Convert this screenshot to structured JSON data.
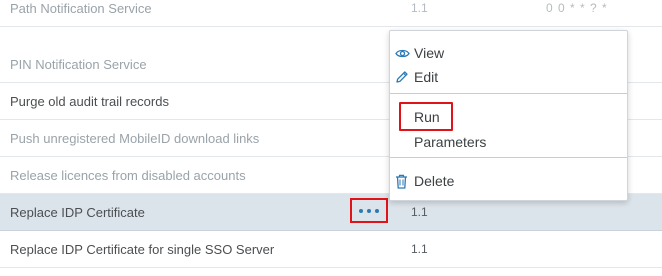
{
  "table": {
    "rows": [
      {
        "name": "Path Notification Service",
        "version": "1.1",
        "schedule": "0 0 * * ? *"
      },
      {
        "name": "PIN Notification Service",
        "version": "",
        "schedule": ""
      },
      {
        "name": "Purge old audit trail records",
        "version": "",
        "schedule": ""
      },
      {
        "name": "Push unregistered MobileID download links",
        "version": "",
        "schedule": ""
      },
      {
        "name": "Release licences from disabled accounts",
        "version": "",
        "schedule": ""
      },
      {
        "name": "Replace IDP Certificate",
        "version": "1.1",
        "schedule": ""
      },
      {
        "name": "Replace IDP Certificate for single SSO Server",
        "version": "1.1",
        "schedule": ""
      }
    ]
  },
  "context_menu": {
    "view": "View",
    "edit": "Edit",
    "run": "Run",
    "parameters": "Parameters",
    "delete": "Delete"
  },
  "colors": {
    "accent": "#2b7ab5",
    "highlight": "#e0131a",
    "selected_row": "#dce4eb"
  }
}
